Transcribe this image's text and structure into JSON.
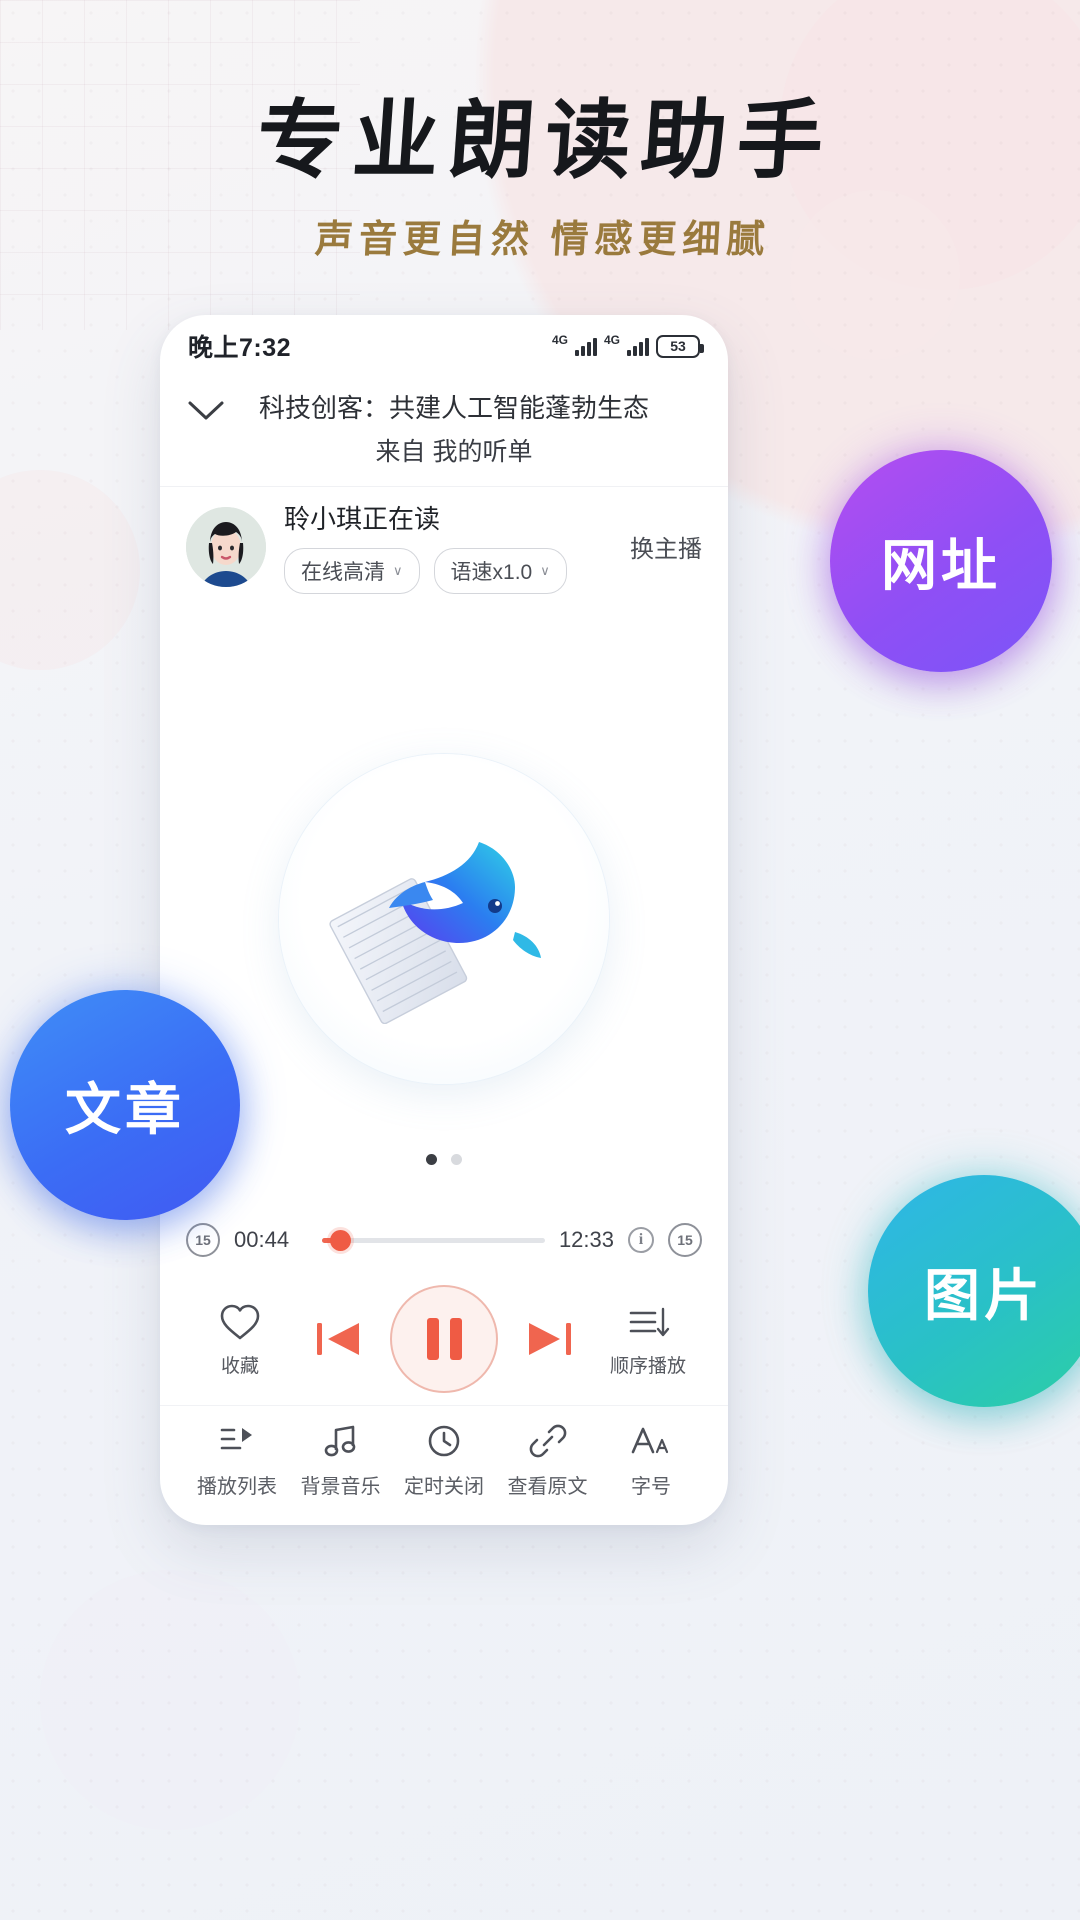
{
  "hero": {
    "title": "专业朗读助手",
    "subtitle": "声音更自然 情感更细腻"
  },
  "badges": [
    {
      "label": "网址",
      "color": "#8f4ff5",
      "name": "badge-url"
    },
    {
      "label": "文章",
      "color": "#3b6df5",
      "name": "badge-article"
    },
    {
      "label": "图片",
      "color": "#29c1c6",
      "name": "badge-image"
    }
  ],
  "phone": {
    "statusbar": {
      "time": "晚上7:32",
      "network_1": "4G",
      "network_2": "4G",
      "battery": "53"
    },
    "player": {
      "collapse_icon": "chevron-down-icon",
      "title": "科技创客：共建人工智能蓬勃生态",
      "source": "来自 我的听单",
      "reader": {
        "name": "聆小琪正在读",
        "quality_chip": "在线高清",
        "speed_chip": "语速x1.0",
        "switch_host": "换主播",
        "chip_caret": "∨"
      },
      "artwork": {
        "icon": "dolphin-book-logo",
        "page_dots": 2,
        "active_dot": 0
      },
      "progress": {
        "rewind_label": "15",
        "forward_label": "15",
        "current_time": "00:44",
        "total_time": "12:33",
        "percent": 8,
        "info_label": "i",
        "accent": "#ef5b44"
      },
      "transport": {
        "favorite_label": "收藏",
        "prev_label": "prev-icon",
        "play_state": "pause",
        "next_label": "next-icon",
        "order_label": "顺序播放"
      },
      "tabs": [
        {
          "label": "播放列表",
          "icon": "playlist-icon"
        },
        {
          "label": "背景音乐",
          "icon": "music-note-icon"
        },
        {
          "label": "定时关闭",
          "icon": "clock-icon"
        },
        {
          "label": "查看原文",
          "icon": "link-icon"
        },
        {
          "label": "字号",
          "icon": "font-size-icon"
        }
      ]
    }
  }
}
